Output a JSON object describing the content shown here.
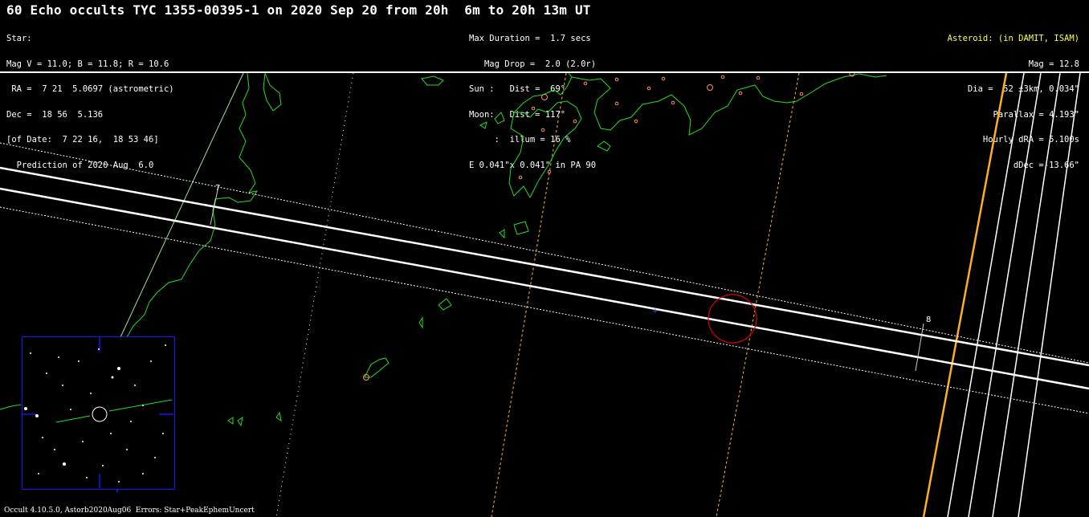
{
  "header": {
    "title": "60 Echo occults TYC 1355-00395-1 on 2020 Sep 20 from 20h  6m to 20h 13m UT",
    "star_lines": [
      "Star:",
      "Mag V = 11.0; B = 11.8; R = 10.6",
      " RA =  7 21  5.0697 (astrometric)",
      "Dec =  18 56  5.136",
      "[of Date:  7 22 16,  18 53 46]",
      "  Prediction of 2020 Aug  6.0"
    ],
    "event_lines": [
      "Max Duration =  1.7 secs",
      "   Mag Drop =  2.0 (2.0r)",
      "Sun :   Dist =  69°",
      "Moon:   Dist = 117°",
      "     :  illum = 16 %",
      "E 0.041\"x 0.041\" in PA 90"
    ],
    "asteroid_heading": "Asteroid: (in DAMIT, ISAM)",
    "asteroid_lines": [
      "Mag = 12.8",
      "Dia =  52 ±3km, 0.034\"",
      "Parallax = 4.193\"",
      "Hourly dRA = 5.100s",
      "dDec =-13.66\""
    ]
  },
  "map": {
    "path_color": "#ffffff",
    "coast_color": "#22dd22",
    "ellipse_color": "#dd0000",
    "sunrise_line_color": "#ffc020",
    "inset_border_color": "#1414ff",
    "hour_labels": [
      "7",
      "8"
    ]
  },
  "footer": "Occult 4.10.5.0, Astorb2020Aug06  Errors: Star+PeakEphemUncert"
}
